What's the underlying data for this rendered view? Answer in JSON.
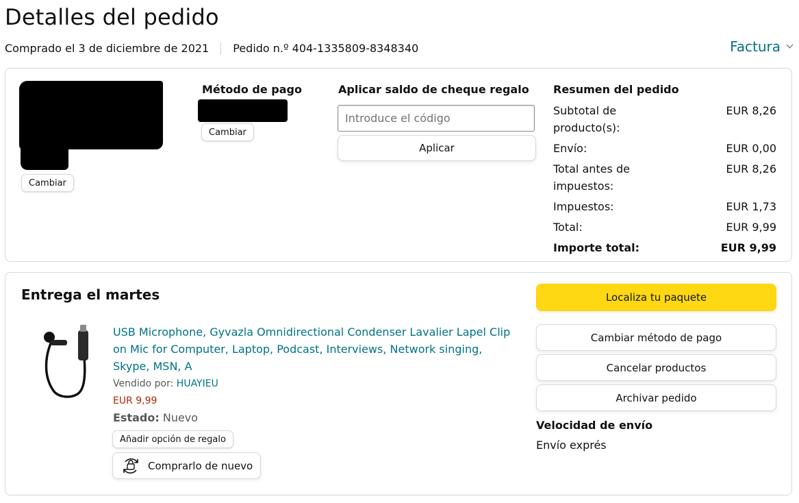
{
  "header": {
    "title": "Detalles del pedido",
    "purchased": "Comprado el 3 de diciembre de 2021",
    "order_number": "Pedido n.º 404-1335809-8348340",
    "invoice_label": "Factura"
  },
  "address": {
    "change_label": "Cambiar"
  },
  "payment": {
    "title": "Método de pago",
    "change_label": "Cambiar"
  },
  "gift_card": {
    "title": "Aplicar saldo de cheque regalo",
    "placeholder": "Introduce el código",
    "apply_label": "Aplicar"
  },
  "summary": {
    "title": "Resumen del pedido",
    "rows": [
      {
        "label": "Subtotal de producto(s):",
        "value": "EUR 8,26"
      },
      {
        "label": "Envío:",
        "value": "EUR 0,00"
      },
      {
        "label": "Total antes de impuestos:",
        "value": "EUR 8,26"
      },
      {
        "label": "Impuestos:",
        "value": "EUR 1,73"
      },
      {
        "label": "Total:",
        "value": "EUR 9,99"
      }
    ],
    "grand_total": {
      "label": "Importe total:",
      "value": "EUR 9,99"
    }
  },
  "delivery": {
    "title": "Entrega el martes",
    "product": {
      "icon": "lavalier-microphone-image",
      "title": "USB Microphone, Gyvazla Omnidirectional Condenser Lavalier Lapel Clip on Mic for Computer, Laptop, Podcast, Interviews, Network singing, Skype, MSN, A",
      "sold_by_label": "Vendido por:",
      "seller": "HUAYIEU",
      "price": "EUR 9,99",
      "condition_label": "Estado:",
      "condition_value": "Nuevo",
      "gift_option_label": "Añadir opción de regalo",
      "buy_again_label": "Comprarlo de nuevo"
    },
    "actions": {
      "track": "Localiza tu paquete",
      "change_payment": "Cambiar método de pago",
      "cancel": "Cancelar productos",
      "archive": "Archivar pedido"
    },
    "shipping_speed_label": "Velocidad de envío",
    "shipping_speed_value": "Envío exprés"
  },
  "colors": {
    "link": "#007185",
    "price": "#B12704",
    "primary_button": "#FFD814",
    "border": "#D5D9D9"
  }
}
